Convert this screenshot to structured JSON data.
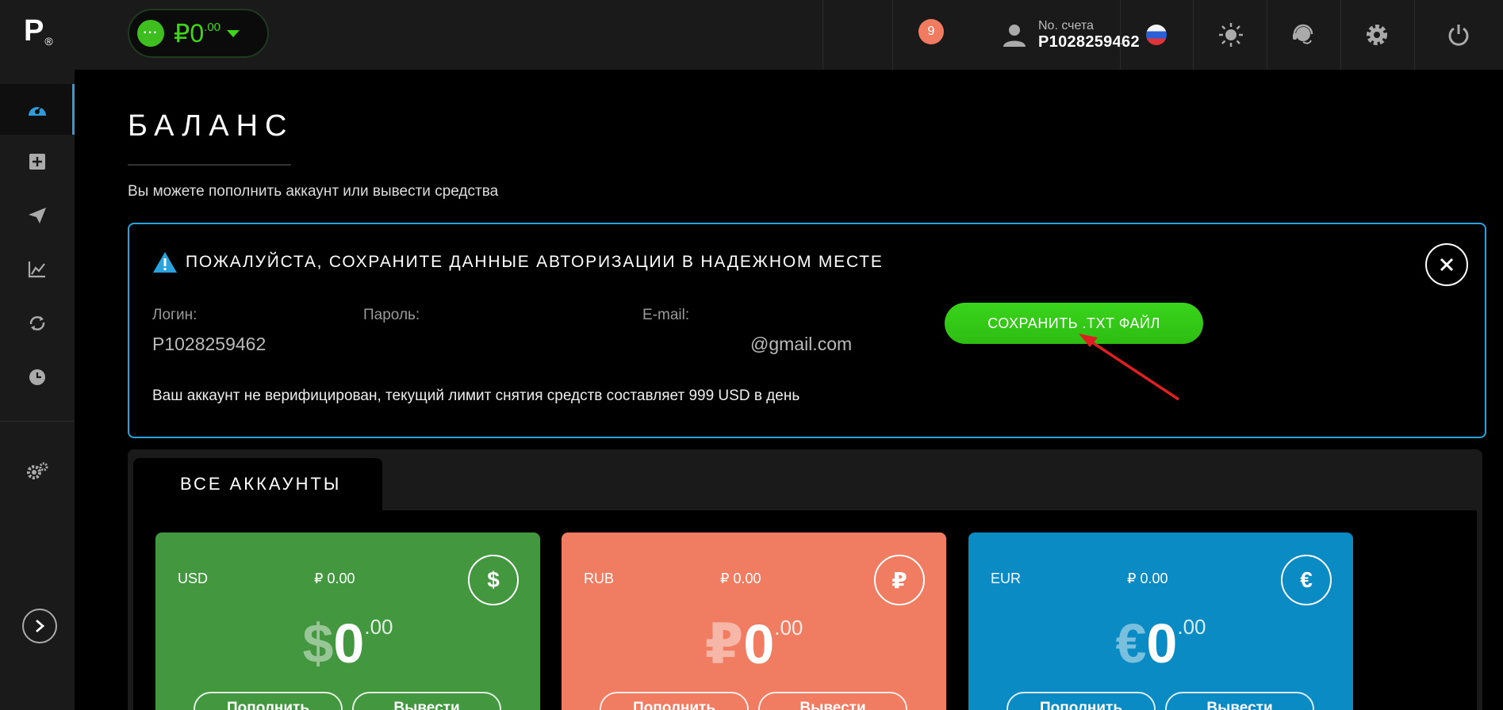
{
  "app": {
    "logo": "P",
    "logo_mark": "®"
  },
  "sidebar": {
    "items": [
      {
        "name": "dashboard",
        "icon": "gauge-icon",
        "active": true
      },
      {
        "name": "deposit",
        "icon": "plus-square-icon"
      },
      {
        "name": "send",
        "icon": "paper-plane-icon"
      },
      {
        "name": "statistics",
        "icon": "chart-line-icon"
      },
      {
        "name": "exchange",
        "icon": "exchange-arrows-icon"
      },
      {
        "name": "history",
        "icon": "clock-icon"
      }
    ],
    "settings_icon": "gears-icon",
    "expand_icon": "chevron-right-icon"
  },
  "header": {
    "balance_dots": "···",
    "balance_symbol": "₽",
    "balance_int": "0",
    "balance_dec": ".00",
    "notifications_count": "9",
    "account_label": "No. счета",
    "account_number": "P1028259462"
  },
  "main": {
    "title": "БАЛАНС",
    "subtitle": "Вы можете пополнить аккаунт или вывести средства"
  },
  "notice": {
    "title": "ПОЖАЛУЙСТА, СОХРАНИТЕ ДАННЫЕ АВТОРИЗАЦИИ В НАДЕЖНОМ МЕСТЕ",
    "login_label": "Логин:",
    "login_value": "P1028259462",
    "password_label": "Пароль:",
    "password_value": "",
    "email_label": "E-mail:",
    "email_value": "@gmail.com",
    "save_button": "СОХРАНИТЬ .TXT ФАЙЛ",
    "footer": "Ваш аккаунт не верифицирован, текущий лимит снятия средств составляет 999 USD в день"
  },
  "accounts": {
    "tab_label": "ВСЕ АККАУНТЫ",
    "cards": [
      {
        "code": "USD",
        "rub": "₽ 0.00",
        "icon": "$",
        "symbol": "$",
        "int": "0",
        "dec": ".00",
        "deposit": "Пополнить",
        "withdraw": "Вывести",
        "color": "#43973f"
      },
      {
        "code": "RUB",
        "rub": "₽ 0.00",
        "icon": "₽",
        "symbol": "₽",
        "int": "0",
        "dec": ".00",
        "deposit": "Пополнить",
        "withdraw": "Вывести",
        "color": "#f07c62"
      },
      {
        "code": "EUR",
        "rub": "₽ 0.00",
        "icon": "€",
        "symbol": "€",
        "int": "0",
        "dec": ".00",
        "deposit": "Пополнить",
        "withdraw": "Вывести",
        "color": "#0a8bc4"
      }
    ]
  },
  "colors": {
    "accent_blue": "#2aa3dc",
    "green": "#3fd61a",
    "badge": "#f07b61",
    "arrow": "#e02020"
  }
}
